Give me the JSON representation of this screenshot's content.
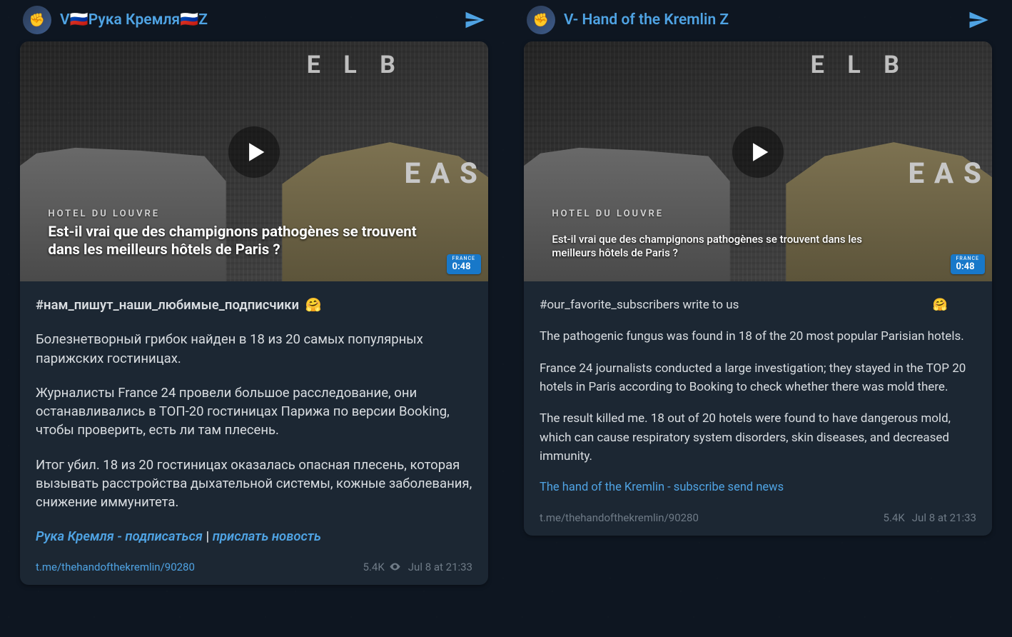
{
  "left": {
    "avatar_emoji": "✊",
    "channel_name": "V🇷🇺Рука Кремля🇷🇺Z",
    "video": {
      "signboard": "E L B",
      "east_text": "E A S",
      "hotel_sign": "HOTEL DU LOUVRE",
      "caption": "Est-il vrai que des champignons pathogènes se trouvent dans les meilleurs hôtels de Paris ?",
      "badge_label": "FRANCE",
      "duration": "0:48"
    },
    "body": {
      "hashtag": "#нам_пишут_наши_любимые_подписчики",
      "emoji": "🤗",
      "p1": "Болезнетворный грибок найден в 18 из 20 самых популярных парижских гостиницах.",
      "p2": "Журналисты France 24 провели большое расследование, они останавливались в ТОП-20 гостиницах Парижа по версии Booking, чтобы проверить, есть ли там плесень.",
      "p3": "Итог убил. 18 из 20 гостиницах оказалась опасная плесень, которая вызывать расстройства дыхательной системы, кожные заболевания, снижение иммунитета.",
      "sub_label": "Рука Кремля - подписаться",
      "sep": " | ",
      "send_label": "прислать новость"
    },
    "meta": {
      "permalink": "t.me/thehandofthekremlin/90280",
      "views": "5.4K",
      "timestamp": "Jul 8 at 21:33"
    }
  },
  "right": {
    "avatar_emoji": "✊",
    "channel_name": "V- Hand of the Kremlin Z",
    "video": {
      "signboard": "E L B",
      "east_text": "E A S",
      "hotel_sign": "HOTEL DU LOUVRE",
      "caption": "Est-il vrai que des champignons pathogènes se trouvent dans les meilleurs hôtels de Paris ?",
      "badge_label": "FRANCE",
      "duration": "0:48"
    },
    "body": {
      "hashtag": "#our_favorite_subscribers write to us",
      "emoji": "🤗",
      "p1": "The pathogenic fungus was found in 18 of the 20 most popular Parisian hotels.",
      "p2": "France 24 journalists conducted a large investigation; they stayed in the TOP 20 hotels in Paris according to Booking to check whether there was mold there.",
      "p3": "The result killed me. 18 out of 20 hotels were found to have dangerous mold, which can cause respiratory system disorders, skin diseases, and decreased immunity.",
      "sub_label": "The hand of the Kremlin - subscribe send news"
    },
    "meta": {
      "permalink": "t.me/thehandofthekremlin/90280",
      "views": "5.4K",
      "timestamp": "Jul 8 at 21:33"
    }
  }
}
